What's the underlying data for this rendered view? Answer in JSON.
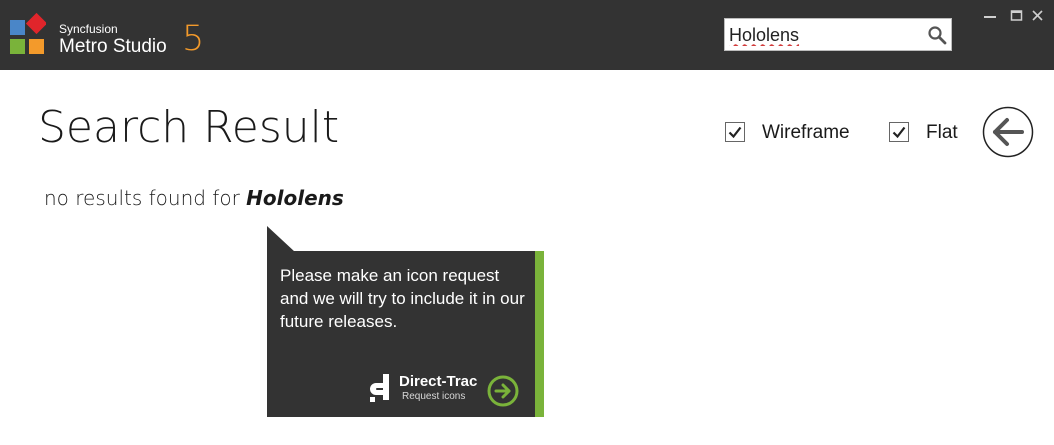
{
  "app": {
    "brand_small": "Syncfusion",
    "brand_name": "Metro Studio",
    "version": "5",
    "logo_colors": [
      "#4a86c8",
      "#e0252b",
      "#7ab33a",
      "#f39a2b"
    ]
  },
  "search": {
    "value": "Hololens",
    "icon": "search-icon"
  },
  "window_controls": [
    "minimize-icon",
    "maximize-icon",
    "close-icon"
  ],
  "page": {
    "title": "Search Result",
    "filters": [
      {
        "label": "Wireframe",
        "checked": true
      },
      {
        "label": "Flat",
        "checked": true
      }
    ],
    "back_icon": "arrow-left-icon",
    "no_results_prefix": "no results found for",
    "search_term": "Hololens"
  },
  "request_tile": {
    "message": "Please make an icon request and we will try to include it in our future releases.",
    "brand_name": "Direct-Trac",
    "brand_sub": "Request icons",
    "accent_color": "#7ab33a",
    "action_icon": "arrow-right-circle-icon"
  }
}
